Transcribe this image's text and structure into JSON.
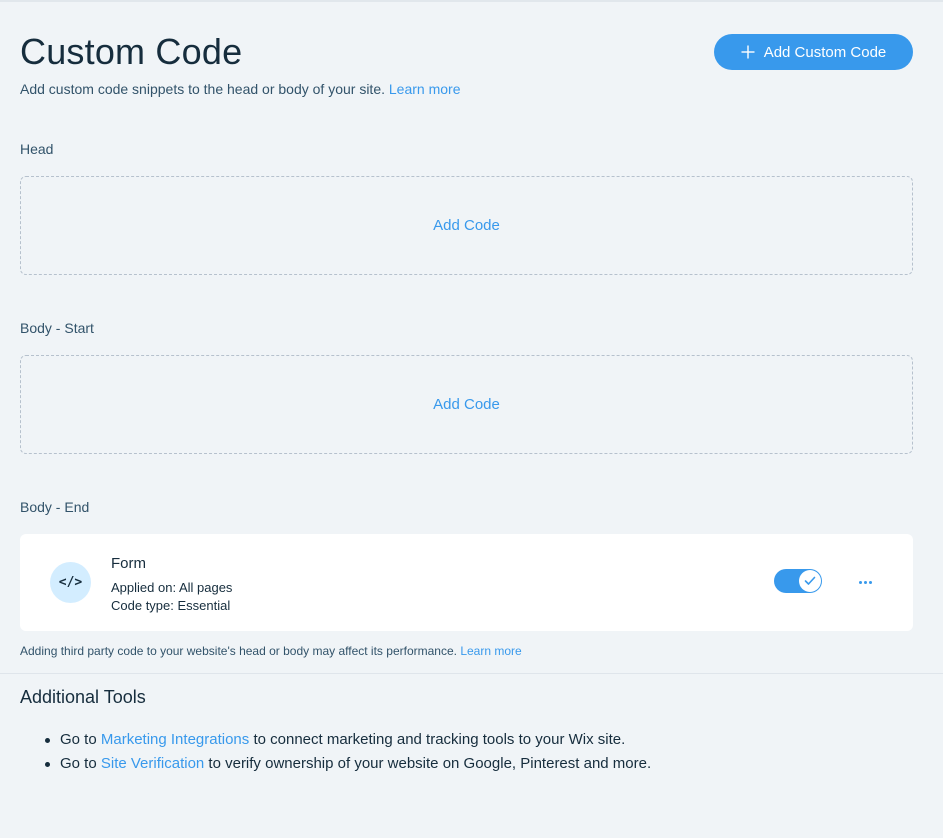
{
  "header": {
    "title": "Custom Code",
    "subtitle": "Add custom code snippets to the head or body of your site.",
    "learn_more": "Learn more",
    "add_button_label": "Add Custom Code",
    "add_button_icon": "plus-icon"
  },
  "sections": {
    "head": {
      "label": "Head",
      "add_code": "Add Code"
    },
    "body_start": {
      "label": "Body - Start",
      "add_code": "Add Code"
    },
    "body_end": {
      "label": "Body - End",
      "snippet": {
        "icon": "code-icon",
        "icon_glyph": "</>",
        "name": "Form",
        "applied_on": "Applied on: All pages",
        "code_type": "Code type: Essential",
        "enabled": true
      }
    }
  },
  "disclaimer": {
    "text": "Adding third party code to your website's head or body may affect its performance.",
    "learn_more": "Learn more"
  },
  "additional_tools": {
    "title": "Additional Tools",
    "items": [
      {
        "prefix": "Go to",
        "link": "Marketing Integrations",
        "suffix": "to connect marketing and tracking tools to your Wix site."
      },
      {
        "prefix": "Go to",
        "link": "Site Verification",
        "suffix": "to verify ownership of your website on Google, Pinterest and more."
      }
    ]
  },
  "colors": {
    "accent": "#3899ec",
    "background": "#f0f4f7",
    "text": "#162d3d",
    "icon_circle": "#d3edff"
  }
}
